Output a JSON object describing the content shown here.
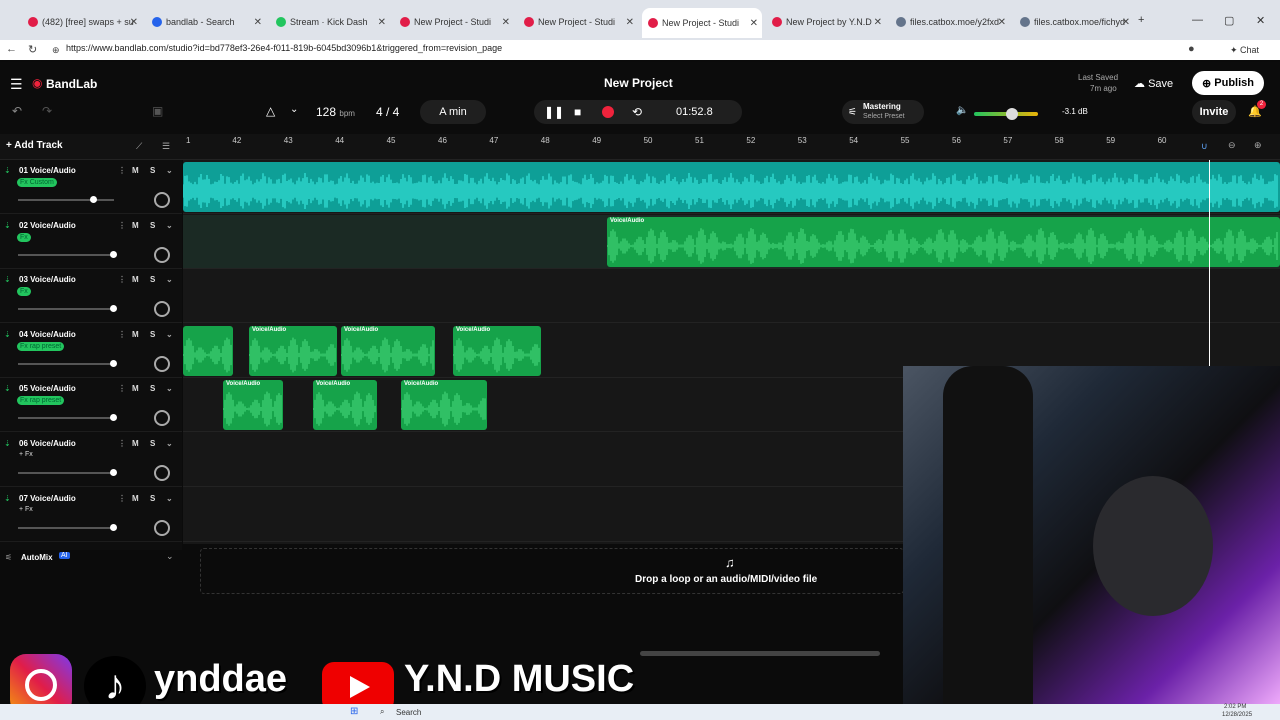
{
  "browser": {
    "tabs": [
      {
        "label": "(482) [free] swaps + su",
        "color": "#e11d48",
        "active": false
      },
      {
        "label": "bandlab - Search",
        "color": "#2563eb",
        "active": false
      },
      {
        "label": "Stream · Kick Dash",
        "color": "#22c55e",
        "active": false
      },
      {
        "label": "New Project - Studi",
        "color": "#e11d48",
        "active": false
      },
      {
        "label": "New Project - Studi",
        "color": "#e11d48",
        "active": false
      },
      {
        "label": "New Project - Studi",
        "color": "#e11d48",
        "active": true
      },
      {
        "label": "New Project by Y.N.D",
        "color": "#e11d48",
        "active": false
      },
      {
        "label": "files.catbox.moe/y2fxd",
        "color": "#64748b",
        "active": false
      },
      {
        "label": "files.catbox.moe/fichyd",
        "color": "#64748b",
        "active": false
      }
    ],
    "url": "https://www.bandlab.com/studio?id=bd778ef3-26e4-f011-819b-6045bd3096b1&triggered_from=revision_page",
    "chat_label": "Chat"
  },
  "header": {
    "logo": "BandLab",
    "project_title": "New Project",
    "last_saved_label": "Last Saved",
    "last_saved_time": "7m ago",
    "save_label": "Save",
    "publish_label": "Publish",
    "invite_label": "Invite",
    "notification_count": "2"
  },
  "transport": {
    "bpm": "128",
    "bpm_unit": "bpm",
    "time_signature": "4 / 4",
    "key": "A min",
    "time": "01:52.8",
    "mastering_label": "Mastering",
    "mastering_preset": "Select Preset",
    "volume_db": "-3.1 dB"
  },
  "ruler": [
    "1",
    "42",
    "43",
    "44",
    "45",
    "46",
    "47",
    "48",
    "49",
    "50",
    "51",
    "52",
    "53",
    "54",
    "55",
    "56",
    "57",
    "58",
    "59",
    "60"
  ],
  "add_track_label": "Add Track",
  "tracks": [
    {
      "name": "01  Voice/Audio",
      "fx": "Fx Custom",
      "fx_style": "badge",
      "volume": 0.78
    },
    {
      "name": "02  Voice/Audio",
      "fx": "Fx",
      "fx_style": "badge",
      "volume": 1.0
    },
    {
      "name": "03  Voice/Audio",
      "fx": "Fx",
      "fx_style": "badge",
      "volume": 1.0
    },
    {
      "name": "04  Voice/Audio",
      "fx": "Fx rap preset",
      "fx_style": "badge",
      "volume": 1.0
    },
    {
      "name": "05  Voice/Audio",
      "fx": "Fx rap preset",
      "fx_style": "badge",
      "volume": 1.0
    },
    {
      "name": "06  Voice/Audio",
      "fx": "+ Fx",
      "fx_style": "plain",
      "volume": 1.0
    },
    {
      "name": "07  Voice/Audio",
      "fx": "+ Fx",
      "fx_style": "plain",
      "volume": 1.0
    }
  ],
  "track_buttons": {
    "mute": "M",
    "solo": "S"
  },
  "clip_label": "Voice/Audio",
  "automix_label": "AutoMix",
  "automix_badge": "AI",
  "drop_zone_text": "Drop a loop or an audio/MIDI/video file",
  "overlay": {
    "social_handle": "ynddae",
    "channel_name": "Y.N.D MUSIC"
  },
  "taskbar": {
    "search_label": "Search",
    "clock_time": "2:02 PM",
    "clock_date": "12/28/2025"
  },
  "colors": {
    "accent_red": "#ef233c",
    "clip_cyan": "#12c9c1",
    "clip_green": "#22c55e",
    "playhead": "#ffffff"
  }
}
